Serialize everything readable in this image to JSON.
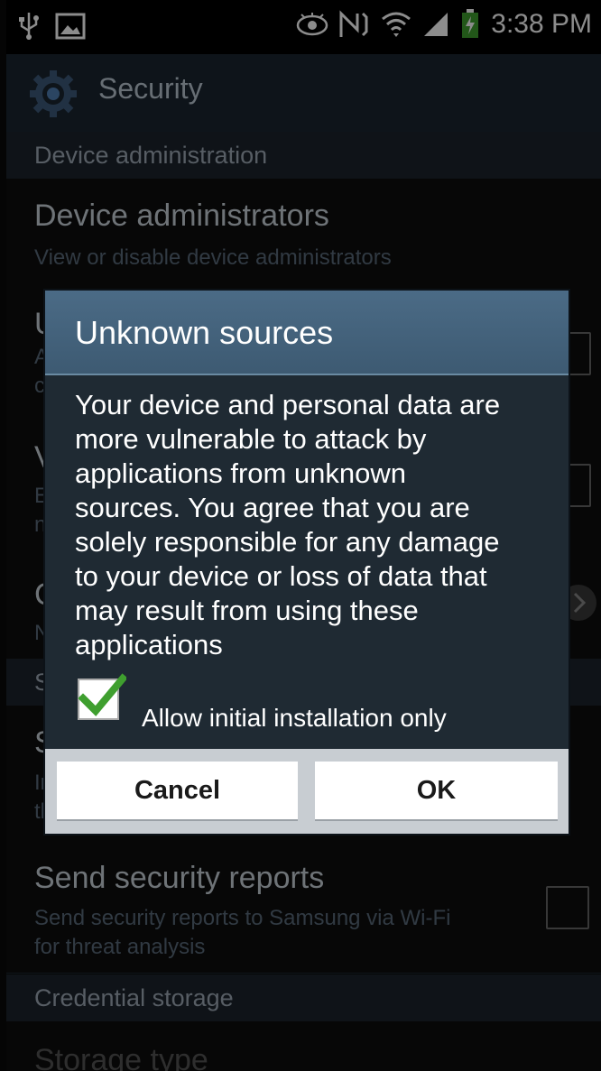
{
  "status_bar": {
    "time": "3:38 PM",
    "icons": [
      "usb-icon",
      "image-icon",
      "eye-icon",
      "nfc-icon",
      "wifi-icon",
      "signal-icon",
      "battery-charging-icon"
    ]
  },
  "action_bar": {
    "title": "Security",
    "icon": "gear-icon"
  },
  "settings": {
    "sections": [
      {
        "header": "Device administration"
      },
      {
        "header": "S"
      },
      {
        "header": "Credential storage"
      }
    ],
    "items": [
      {
        "title": "Device administrators",
        "subtitle": "View or disable device administrators"
      },
      {
        "title": "U",
        "subtitle_lines": [
          "A",
          "c"
        ]
      },
      {
        "title": "V",
        "subtitle_lines": [
          "E",
          "n"
        ]
      },
      {
        "title": "C",
        "subtitle_lines": [
          "N"
        ]
      },
      {
        "title": "S",
        "subtitle_lines": [
          "Ir",
          "th"
        ]
      },
      {
        "title": "Send security reports",
        "subtitle_lines": [
          "Send security reports to Samsung via Wi-Fi",
          "for threat analysis"
        ]
      },
      {
        "title": "Storage type"
      }
    ]
  },
  "dialog": {
    "title": "Unknown sources",
    "message_lines": [
      "Your device and personal data are",
      "more vulnerable to attack by",
      "applications from unknown",
      "sources. You agree that you are",
      "solely responsible for any damage",
      "to your device or loss of data that",
      "may result from using these",
      "applications"
    ],
    "checkbox_label": "Allow initial installation only",
    "checkbox_checked": true,
    "cancel_label": "Cancel",
    "ok_label": "OK"
  },
  "colors": {
    "accent": "#3f9f2f",
    "dialog_title_bg": "#4b6b86",
    "dialog_body_bg": "#1f2a33"
  }
}
